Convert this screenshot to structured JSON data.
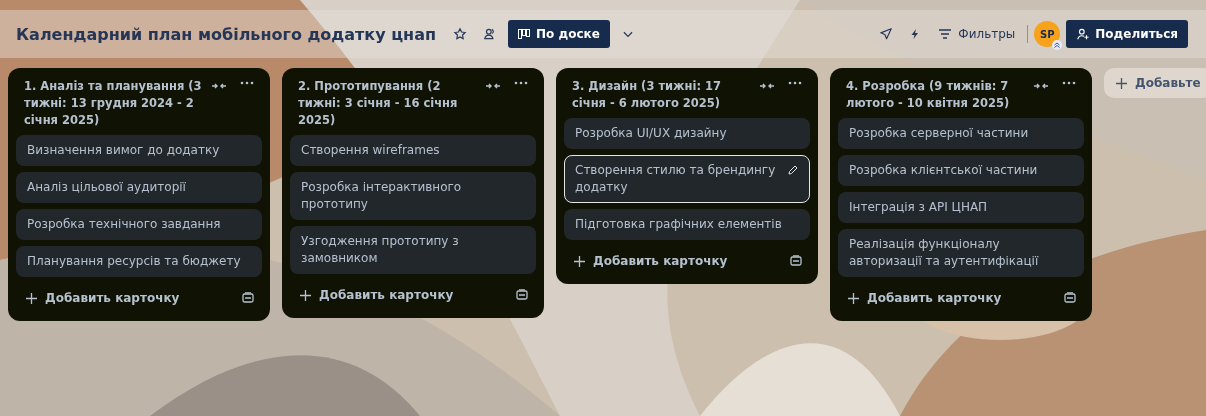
{
  "board": {
    "title": "Календарний план мобільного додатку цнап",
    "view_button": "По доске",
    "filters": "Фильтры",
    "avatar": "SP",
    "share": "Поделиться"
  },
  "lists": [
    {
      "title": "1. Аналіз та планування (3 тижні: 13 грудня 2024 - 2 січня 2025)",
      "cards": [
        {
          "text": "Визначення вимог до додатку",
          "selected": false
        },
        {
          "text": "Аналіз цільової аудиторії",
          "selected": false
        },
        {
          "text": "Розробка технічного завдання",
          "selected": false
        },
        {
          "text": "Планування ресурсів та бюджету",
          "selected": false
        }
      ],
      "add_card": "Добавить карточку"
    },
    {
      "title": "2. Прототипування (2 тижні: 3 січня - 16 січня 2025)",
      "cards": [
        {
          "text": "Створення wireframes",
          "selected": false
        },
        {
          "text": "Розробка інтерактивного прототипу",
          "selected": false
        },
        {
          "text": "Узгодження прототипу з замовником",
          "selected": false
        }
      ],
      "add_card": "Добавить карточку"
    },
    {
      "title": "3. Дизайн (3 тижні: 17 січня - 6 лютого 2025)",
      "cards": [
        {
          "text": "Розробка UI/UX дизайну",
          "selected": false
        },
        {
          "text": "Створення стилю та брендингу додатку",
          "selected": true
        },
        {
          "text": "Підготовка графічних елементів",
          "selected": false
        }
      ],
      "add_card": "Добавить карточку"
    },
    {
      "title": "4. Розробка (9 тижнів: 7 лютого - 10 квітня 2025)",
      "cards": [
        {
          "text": "Розробка серверної частини",
          "selected": false
        },
        {
          "text": "Розробка клієнтської частини",
          "selected": false
        },
        {
          "text": "Інтеграція з API ЦНАП",
          "selected": false
        },
        {
          "text": "Реалізація функціоналу авторизації та аутентифікації",
          "selected": false
        }
      ],
      "add_card": "Добавить карточку"
    }
  ],
  "add_list": "Добавьте"
}
